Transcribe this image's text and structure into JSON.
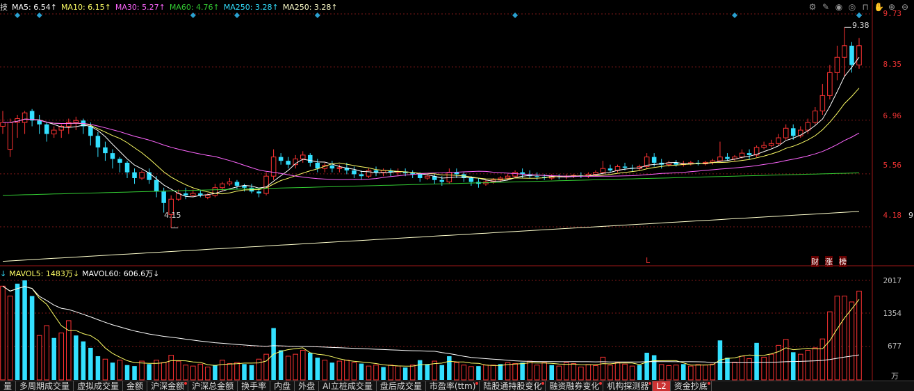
{
  "indicator_bar": {
    "prefix": "技",
    "ma5": "MA5: 6.54↑",
    "ma10": "MA10: 6.15↑",
    "ma30": "MA30: 5.27↑",
    "ma60": "MA60: 4.76↑",
    "ma250": "MA250: 3.28↑",
    "ma250b": "MA250: 3.28↑"
  },
  "volume_bar": {
    "prefix": "↓",
    "mavol5": "MAVOL5: 1483万↓",
    "mavol60": "MAVOL60: 606.6万↓"
  },
  "price_axis": [
    "9.73",
    "8.35",
    "6.96",
    "5.56",
    "4.18"
  ],
  "volume_axis": [
    "2017",
    "1354",
    "677",
    "万"
  ],
  "annotations": {
    "high": "9.38",
    "low": "4.15",
    "l_marker": "L",
    "cai": "财",
    "zhang": "涨",
    "bang": "榜"
  },
  "right_edge_labels": {
    "a": "9"
  },
  "colors": {
    "up": "#ff3333",
    "down": "#33e0ff",
    "ma5": "#ffffff",
    "ma10": "#ffff66",
    "ma30": "#ff66ff",
    "ma60": "#33cc33",
    "ma250": "#ffffcc",
    "grid": "#801818"
  },
  "tabs": [
    {
      "label": "量",
      "dot": false
    },
    {
      "label": "多周期成交量",
      "dot": false
    },
    {
      "label": "虚拟成交量",
      "dot": false
    },
    {
      "label": "金额",
      "dot": false
    },
    {
      "label": "沪深金额",
      "dot": true
    },
    {
      "label": "沪深总金额",
      "dot": false
    },
    {
      "label": "换手率",
      "dot": false
    },
    {
      "label": "内盘",
      "dot": false
    },
    {
      "label": "外盘",
      "dot": false
    },
    {
      "label": "AI立桩成交量",
      "dot": false
    },
    {
      "label": "盘后成交量",
      "dot": false
    },
    {
      "label": "市盈率(ttm)",
      "dot": true
    },
    {
      "label": "陆股通持股变化",
      "dot": true
    },
    {
      "label": "融资融券变化",
      "dot": true
    },
    {
      "label": "机构探测器",
      "dot": true
    },
    {
      "label": "L2",
      "dot": false
    },
    {
      "label": "资金抄底",
      "dot": true
    }
  ],
  "chart_data": {
    "type": "candlestick",
    "ylim": [
      3.2,
      9.73
    ],
    "ma250_range": [
      3.28,
      4.58
    ],
    "volume_ylim": [
      0,
      2017
    ],
    "candles": [
      [
        6.8,
        7.2,
        6.9,
        6.6
      ],
      [
        6.2,
        7.0,
        6.9,
        6.0
      ],
      [
        6.9,
        7.1,
        7.0,
        6.5
      ],
      [
        6.9,
        7.2,
        7.15,
        6.6
      ],
      [
        7.2,
        7.25,
        6.95,
        6.8
      ],
      [
        6.95,
        7.1,
        6.85,
        6.6
      ],
      [
        6.85,
        6.9,
        6.6,
        6.4
      ],
      [
        6.6,
        6.8,
        6.7,
        6.5
      ],
      [
        6.7,
        6.85,
        6.8,
        6.5
      ],
      [
        6.8,
        7.0,
        6.9,
        6.6
      ],
      [
        6.9,
        7.05,
        6.95,
        6.7
      ],
      [
        6.95,
        7.0,
        6.8,
        6.6
      ],
      [
        6.8,
        6.9,
        6.55,
        6.3
      ],
      [
        6.55,
        6.65,
        6.25,
        6.0
      ],
      [
        6.25,
        6.4,
        6.1,
        5.9
      ],
      [
        6.1,
        6.2,
        5.95,
        5.7
      ],
      [
        5.95,
        6.0,
        5.85,
        5.6
      ],
      [
        5.85,
        5.9,
        5.6,
        5.45
      ],
      [
        5.6,
        5.7,
        5.45,
        5.3
      ],
      [
        5.45,
        5.65,
        5.6,
        5.4
      ],
      [
        5.6,
        5.7,
        5.4,
        5.3
      ],
      [
        5.4,
        5.5,
        5.1,
        4.95
      ],
      [
        5.1,
        5.2,
        4.8,
        4.55
      ],
      [
        4.5,
        5.0,
        4.9,
        4.15
      ],
      [
        4.9,
        5.15,
        5.05,
        4.85
      ],
      [
        5.05,
        5.2,
        5.0,
        4.9
      ],
      [
        5.0,
        5.15,
        5.05,
        4.95
      ],
      [
        5.05,
        5.15,
        5.0,
        4.95
      ],
      [
        4.95,
        5.05,
        5.0,
        4.9
      ],
      [
        5.0,
        5.3,
        5.2,
        4.95
      ],
      [
        5.2,
        5.35,
        5.3,
        5.1
      ],
      [
        5.3,
        5.45,
        5.35,
        5.25
      ],
      [
        5.35,
        5.4,
        5.25,
        5.15
      ],
      [
        5.25,
        5.3,
        5.2,
        5.1
      ],
      [
        5.2,
        5.3,
        5.1,
        5.05
      ],
      [
        5.1,
        5.2,
        5.05,
        4.95
      ],
      [
        5.05,
        5.6,
        5.5,
        5.0
      ],
      [
        5.5,
        6.2,
        6.0,
        5.4
      ],
      [
        6.0,
        6.1,
        5.9,
        5.8
      ],
      [
        5.9,
        6.0,
        5.8,
        5.7
      ],
      [
        5.8,
        6.05,
        5.95,
        5.7
      ],
      [
        5.95,
        6.15,
        6.05,
        5.85
      ],
      [
        6.05,
        6.1,
        5.85,
        5.75
      ],
      [
        5.85,
        5.95,
        5.7,
        5.6
      ],
      [
        5.7,
        5.85,
        5.78,
        5.6
      ],
      [
        5.78,
        5.9,
        5.7,
        5.6
      ],
      [
        5.7,
        5.8,
        5.72,
        5.6
      ],
      [
        5.72,
        5.85,
        5.65,
        5.55
      ],
      [
        5.65,
        5.75,
        5.55,
        5.45
      ],
      [
        5.55,
        5.65,
        5.5,
        5.4
      ],
      [
        5.5,
        5.7,
        5.65,
        5.45
      ],
      [
        5.65,
        5.75,
        5.6,
        5.5
      ],
      [
        5.6,
        5.7,
        5.65,
        5.5
      ],
      [
        5.65,
        5.7,
        5.6,
        5.5
      ],
      [
        5.6,
        5.7,
        5.62,
        5.5
      ],
      [
        5.62,
        5.7,
        5.58,
        5.5
      ],
      [
        5.58,
        5.65,
        5.55,
        5.45
      ],
      [
        5.55,
        5.6,
        5.45,
        5.35
      ],
      [
        5.45,
        5.55,
        5.5,
        5.4
      ],
      [
        5.5,
        5.55,
        5.4,
        5.3
      ],
      [
        5.4,
        5.5,
        5.35,
        5.25
      ],
      [
        5.35,
        5.7,
        5.6,
        5.3
      ],
      [
        5.6,
        5.7,
        5.55,
        5.45
      ],
      [
        5.55,
        5.6,
        5.45,
        5.35
      ],
      [
        5.45,
        5.5,
        5.35,
        5.25
      ],
      [
        5.35,
        5.45,
        5.3,
        5.2
      ],
      [
        5.3,
        5.4,
        5.35,
        5.25
      ],
      [
        5.35,
        5.45,
        5.4,
        5.3
      ],
      [
        5.4,
        5.5,
        5.45,
        5.35
      ],
      [
        5.45,
        5.55,
        5.5,
        5.4
      ],
      [
        5.5,
        5.65,
        5.6,
        5.45
      ],
      [
        5.6,
        5.7,
        5.55,
        5.45
      ],
      [
        5.55,
        5.65,
        5.5,
        5.45
      ],
      [
        5.5,
        5.6,
        5.48,
        5.4
      ],
      [
        5.48,
        5.55,
        5.45,
        5.4
      ],
      [
        5.45,
        5.55,
        5.5,
        5.4
      ],
      [
        5.5,
        5.55,
        5.48,
        5.42
      ],
      [
        5.48,
        5.55,
        5.5,
        5.42
      ],
      [
        5.5,
        5.55,
        5.52,
        5.45
      ],
      [
        5.52,
        5.6,
        5.5,
        5.45
      ],
      [
        5.5,
        5.6,
        5.55,
        5.45
      ],
      [
        5.55,
        5.65,
        5.6,
        5.5
      ],
      [
        5.6,
        5.9,
        5.7,
        5.55
      ],
      [
        5.7,
        5.8,
        5.65,
        5.6
      ],
      [
        5.65,
        5.8,
        5.75,
        5.6
      ],
      [
        5.75,
        5.85,
        5.72,
        5.65
      ],
      [
        5.72,
        5.8,
        5.7,
        5.62
      ],
      [
        5.7,
        5.8,
        5.75,
        5.65
      ],
      [
        5.75,
        6.1,
        6.0,
        5.7
      ],
      [
        6.0,
        6.1,
        5.85,
        5.75
      ],
      [
        5.85,
        5.95,
        5.8,
        5.7
      ],
      [
        5.8,
        5.9,
        5.85,
        5.75
      ],
      [
        5.85,
        5.92,
        5.8,
        5.75
      ],
      [
        5.8,
        5.9,
        5.82,
        5.75
      ],
      [
        5.82,
        5.9,
        5.85,
        5.78
      ],
      [
        5.85,
        5.92,
        5.82,
        5.78
      ],
      [
        5.82,
        5.9,
        5.86,
        5.78
      ],
      [
        5.86,
        5.95,
        5.9,
        5.8
      ],
      [
        5.9,
        6.4,
        6.0,
        5.85
      ],
      [
        6.0,
        6.1,
        5.95,
        5.9
      ],
      [
        5.95,
        6.05,
        6.0,
        5.9
      ],
      [
        6.0,
        6.2,
        6.1,
        5.95
      ],
      [
        6.1,
        6.2,
        6.05,
        5.95
      ],
      [
        6.05,
        6.3,
        6.25,
        6.0
      ],
      [
        6.25,
        6.4,
        6.3,
        6.2
      ],
      [
        6.3,
        6.45,
        6.35,
        6.25
      ],
      [
        6.35,
        6.6,
        6.5,
        6.3
      ],
      [
        6.5,
        6.85,
        6.75,
        6.45
      ],
      [
        6.75,
        6.85,
        6.55,
        6.45
      ],
      [
        6.55,
        6.8,
        6.7,
        6.5
      ],
      [
        6.7,
        7.0,
        6.9,
        6.6
      ],
      [
        6.9,
        7.3,
        7.2,
        6.85
      ],
      [
        7.2,
        7.9,
        7.6,
        7.1
      ],
      [
        7.6,
        8.4,
        8.2,
        7.5
      ],
      [
        8.2,
        8.9,
        8.6,
        8.0
      ],
      [
        8.6,
        9.38,
        8.9,
        8.1
      ],
      [
        8.9,
        9.0,
        8.4,
        8.2
      ],
      [
        8.4,
        9.1,
        8.9,
        8.3
      ]
    ],
    "volumes": [
      [
        1900,
        1
      ],
      [
        1700,
        1
      ],
      [
        1950,
        0
      ],
      [
        2017,
        0
      ],
      [
        1700,
        0
      ],
      [
        900,
        1
      ],
      [
        1100,
        1
      ],
      [
        850,
        0
      ],
      [
        950,
        1
      ],
      [
        1200,
        1
      ],
      [
        900,
        0
      ],
      [
        780,
        0
      ],
      [
        650,
        0
      ],
      [
        480,
        0
      ],
      [
        420,
        1
      ],
      [
        350,
        0
      ],
      [
        400,
        1
      ],
      [
        300,
        0
      ],
      [
        280,
        0
      ],
      [
        380,
        1
      ],
      [
        320,
        0
      ],
      [
        400,
        1
      ],
      [
        350,
        1
      ],
      [
        500,
        1
      ],
      [
        380,
        1
      ],
      [
        300,
        1
      ],
      [
        280,
        1
      ],
      [
        320,
        1
      ],
      [
        260,
        1
      ],
      [
        300,
        0
      ],
      [
        400,
        1
      ],
      [
        330,
        1
      ],
      [
        350,
        1
      ],
      [
        320,
        0
      ],
      [
        300,
        0
      ],
      [
        420,
        1
      ],
      [
        520,
        1
      ],
      [
        1050,
        0
      ],
      [
        600,
        0
      ],
      [
        480,
        1
      ],
      [
        520,
        1
      ],
      [
        600,
        1
      ],
      [
        550,
        0
      ],
      [
        450,
        0
      ],
      [
        400,
        1
      ],
      [
        350,
        0
      ],
      [
        380,
        1
      ],
      [
        400,
        1
      ],
      [
        350,
        1
      ],
      [
        330,
        0
      ],
      [
        280,
        1
      ],
      [
        300,
        1
      ],
      [
        260,
        0
      ],
      [
        300,
        1
      ],
      [
        280,
        1
      ],
      [
        250,
        0
      ],
      [
        300,
        1
      ],
      [
        400,
        0
      ],
      [
        320,
        0
      ],
      [
        380,
        1
      ],
      [
        300,
        0
      ],
      [
        480,
        0
      ],
      [
        350,
        1
      ],
      [
        300,
        1
      ],
      [
        270,
        1
      ],
      [
        280,
        0
      ],
      [
        300,
        1
      ],
      [
        300,
        1
      ],
      [
        320,
        0
      ],
      [
        350,
        1
      ],
      [
        330,
        1
      ],
      [
        350,
        0
      ],
      [
        380,
        1
      ],
      [
        300,
        1
      ],
      [
        350,
        1
      ],
      [
        300,
        0
      ],
      [
        280,
        1
      ],
      [
        350,
        1
      ],
      [
        330,
        1
      ],
      [
        260,
        1
      ],
      [
        310,
        1
      ],
      [
        290,
        1
      ],
      [
        460,
        1
      ],
      [
        300,
        1
      ],
      [
        350,
        1
      ],
      [
        320,
        1
      ],
      [
        280,
        1
      ],
      [
        300,
        0
      ],
      [
        550,
        0
      ],
      [
        500,
        0
      ],
      [
        310,
        1
      ],
      [
        290,
        1
      ],
      [
        300,
        1
      ],
      [
        320,
        0
      ],
      [
        280,
        1
      ],
      [
        310,
        1
      ],
      [
        300,
        1
      ],
      [
        320,
        1
      ],
      [
        800,
        0
      ],
      [
        450,
        0
      ],
      [
        360,
        1
      ],
      [
        480,
        1
      ],
      [
        430,
        1
      ],
      [
        750,
        0
      ],
      [
        460,
        1
      ],
      [
        520,
        1
      ],
      [
        700,
        1
      ],
      [
        820,
        1
      ],
      [
        560,
        0
      ],
      [
        520,
        1
      ],
      [
        600,
        1
      ],
      [
        650,
        1
      ],
      [
        830,
        1
      ],
      [
        1380,
        1
      ],
      [
        1700,
        1
      ],
      [
        1700,
        1
      ],
      [
        1580,
        1
      ],
      [
        1800,
        1
      ]
    ],
    "ma5_note": "",
    "xlabel": "",
    "ylabel": ""
  }
}
